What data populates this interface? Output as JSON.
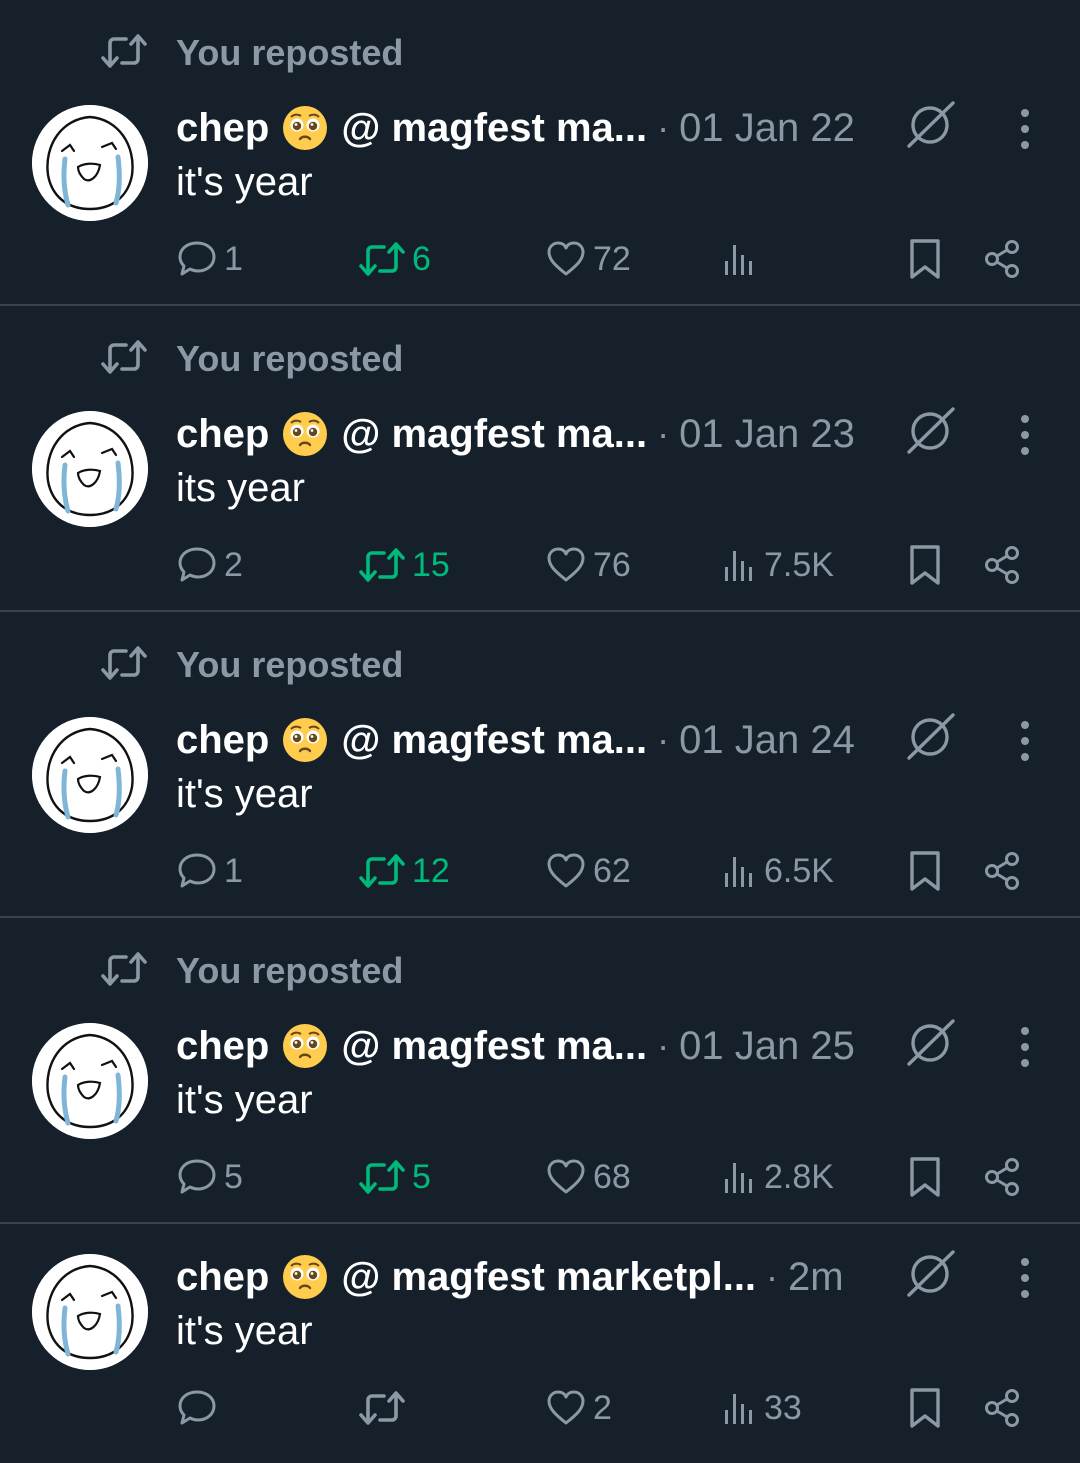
{
  "colors": {
    "background": "#15202b",
    "text_primary": "#ffffff",
    "text_secondary": "#8b98a5",
    "repost_active": "#00ba7c",
    "divider": "#38444d"
  },
  "posts": [
    {
      "reposted_label": "You reposted",
      "display_name": "chep",
      "name_emoji": "pleading-face-emoji",
      "handle": "@ magfest ma...",
      "separator": "·",
      "date": "01 Jan 22",
      "text": "it's year",
      "replies": "1",
      "reposts": "6",
      "reposted_by_me": true,
      "likes": "72",
      "views": ""
    },
    {
      "reposted_label": "You reposted",
      "display_name": "chep",
      "name_emoji": "pleading-face-emoji",
      "handle": "@ magfest ma...",
      "separator": "·",
      "date": "01 Jan 23",
      "text": "its year",
      "replies": "2",
      "reposts": "15",
      "reposted_by_me": true,
      "likes": "76",
      "views": "7.5K"
    },
    {
      "reposted_label": "You reposted",
      "display_name": "chep",
      "name_emoji": "pleading-face-emoji",
      "handle": "@ magfest ma...",
      "separator": "·",
      "date": "01 Jan 24",
      "text": "it's year",
      "replies": "1",
      "reposts": "12",
      "reposted_by_me": true,
      "likes": "62",
      "views": "6.5K"
    },
    {
      "reposted_label": "You reposted",
      "display_name": "chep",
      "name_emoji": "pleading-face-emoji",
      "handle": "@ magfest ma...",
      "separator": "·",
      "date": "01 Jan 25",
      "text": "it's year",
      "replies": "5",
      "reposts": "5",
      "reposted_by_me": true,
      "likes": "68",
      "views": "2.8K"
    },
    {
      "reposted_label": "",
      "display_name": "chep",
      "name_emoji": "pleading-face-emoji",
      "handle": "@ magfest marketpl...",
      "separator": "·",
      "date": "2m",
      "text": "it's year",
      "replies": "",
      "reposts": "",
      "reposted_by_me": false,
      "likes": "2",
      "views": "33"
    }
  ],
  "icons": {
    "repost": "repost-icon",
    "reply": "reply-icon",
    "like": "heart-icon",
    "views": "views-icon",
    "bookmark": "bookmark-icon",
    "share": "share-icon",
    "grok": "grok-icon",
    "more": "more-vertical-icon"
  }
}
